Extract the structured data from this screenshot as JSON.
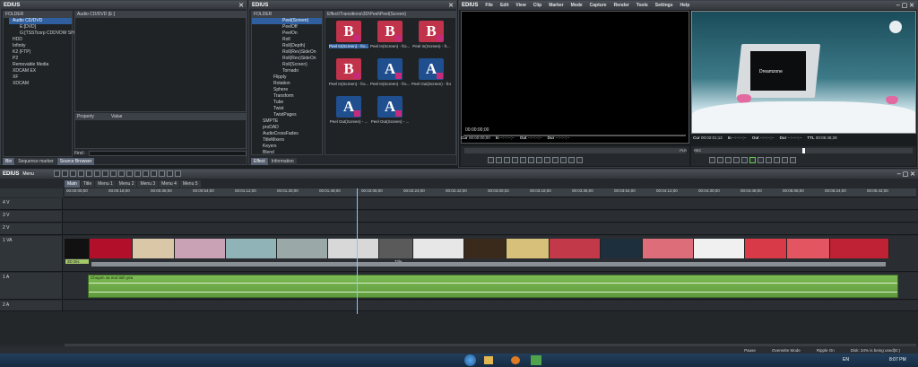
{
  "app": {
    "name": "EDIUS",
    "menu": "Menu"
  },
  "bin_panel": {
    "title": "EDIUS",
    "folder_header": "FOLDER",
    "tree": [
      "Audio CD/DVD",
      "E:[DVD]",
      "G:[TSSTcorp CDDVDW SH-S222A]",
      "HDD",
      "Infinity",
      "K2 (FTP)",
      "P2",
      "Removable Media",
      "XDCAM EX",
      "XF",
      "XDCAM"
    ],
    "content_title": "Audio CD/DVD [E:]",
    "prop_header": "Property",
    "value_header": "Value",
    "find_label": "Find :",
    "tabs": [
      "Bin",
      "Sequence marker",
      "Source Browser"
    ]
  },
  "effect_panel": {
    "title": "EDIUS",
    "folder_header": "FOLDER",
    "path": "Effect\\Transitions\\3D\\Peel\\Peel(Screen)",
    "tree": [
      "Peel(Screen)",
      "PeelOff",
      "PeelOn",
      "Roll",
      "Roll(Depth)",
      "Roll(Rev)SideOn",
      "Roll(Rev)SideOn",
      "Roll(Screen)",
      "Tornado",
      "Flipply",
      "Rotation",
      "Sphere",
      "Transform",
      "Tube",
      "Twist",
      "TwistPages",
      "SMPTE",
      "proDAD",
      "AudioCrossFades",
      "TitleMixers",
      "Keyers",
      "Blend"
    ],
    "thumbnails": [
      {
        "glyph": "B",
        "caption": "Peel In(Screen) - fro...",
        "color": "#c0334a",
        "selected": true
      },
      {
        "glyph": "B",
        "caption": "Peel In(Screen) - fro...",
        "color": "#c0334a",
        "selected": false
      },
      {
        "glyph": "B",
        "caption": "Peel In(Screen) - fr...",
        "color": "#c0334a",
        "selected": false
      },
      {
        "glyph": "B",
        "caption": "Peel In(Screen) - fro...",
        "color": "#c0334a",
        "selected": false
      },
      {
        "glyph": "A",
        "caption": "Peel In(Screen) - fro...",
        "color": "#1f4f8f",
        "selected": false
      },
      {
        "glyph": "A",
        "caption": "Peel Out(Screen) - fro...",
        "color": "#1f4f8f",
        "selected": false
      },
      {
        "glyph": "A",
        "caption": "Peel Out(Screen) - ...",
        "color": "#1f4f8f",
        "selected": false
      },
      {
        "glyph": "A",
        "caption": "Peel Out(Screen) - ...",
        "color": "#1f4f8f",
        "selected": false
      }
    ],
    "tabs": [
      "Effect",
      "Information"
    ]
  },
  "preview": {
    "app_title": "EDIUS",
    "menu": [
      "File",
      "Edit",
      "View",
      "Clip",
      "Marker",
      "Mode",
      "Capture",
      "Render",
      "Tools",
      "Settings",
      "Help"
    ],
    "player_tc": "00:00:00;00",
    "player_cur": "00:00:00;00",
    "rec_cur": "00:02:01;12",
    "rec_ttl": "00:05:45;28",
    "in_label": "In",
    "out_label": "Out",
    "dur_label": "Dur",
    "ttl_label": "TTL",
    "cur_label": "Cur",
    "empty_tc": "--:--:--;--",
    "player_tag": "PLR",
    "rec_tag": "REC",
    "screen_text": "Dreamzone"
  },
  "timeline": {
    "tabs": [
      "Main",
      "Title",
      "Menu 1",
      "Menu 2",
      "Menu 3",
      "Menu 4",
      "Menu 5"
    ],
    "ruler": [
      "00:00:00;00",
      "00:00:18;00",
      "00:00:36;00",
      "00:00:54;00",
      "00:01:12;00",
      "00:01:30;00",
      "00:01:48;00",
      "00:02:06;00",
      "00:02:24;00",
      "00:02:42;00",
      "00:03:00;02",
      "00:03:18;00",
      "00:03:36;00",
      "00:03:54;00",
      "00:04:12;00",
      "00:04:30;00",
      "00:04:48;00",
      "00:05:06;00",
      "00:05:24;00",
      "00:05:42;00"
    ],
    "tracks": [
      "4 V",
      "3 V",
      "2 V",
      "1 VA",
      "1 A",
      "2 A"
    ],
    "clip_label_v": "3D Dis",
    "title_label": "Title",
    "audio_clip": "Chuyen va mot tinh yeu"
  },
  "status": {
    "pause": "Pause",
    "overwrite": "Overwrite Mode",
    "ripple": "Ripple On",
    "disk": "Disk: 34% is being used(E:)"
  },
  "taskbar": {
    "lang": "EN",
    "time": "8:07 PM"
  }
}
